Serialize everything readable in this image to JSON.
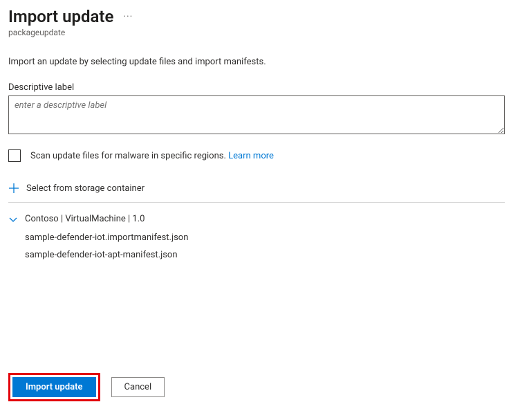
{
  "header": {
    "title": "Import update",
    "subtitle": "packageupdate"
  },
  "description": "Import an update by selecting update files and import manifests.",
  "labelField": {
    "label": "Descriptive label",
    "placeholder": "enter a descriptive label",
    "value": ""
  },
  "scan": {
    "label": "Scan update files for malware in specific regions. ",
    "linkText": "Learn more"
  },
  "storage": {
    "label": "Select from storage container"
  },
  "package": {
    "title": "Contoso | VirtualMachine | 1.0",
    "files": [
      "sample-defender-iot.importmanifest.json",
      "sample-defender-iot-apt-manifest.json"
    ]
  },
  "buttons": {
    "primary": "Import update",
    "cancel": "Cancel"
  }
}
